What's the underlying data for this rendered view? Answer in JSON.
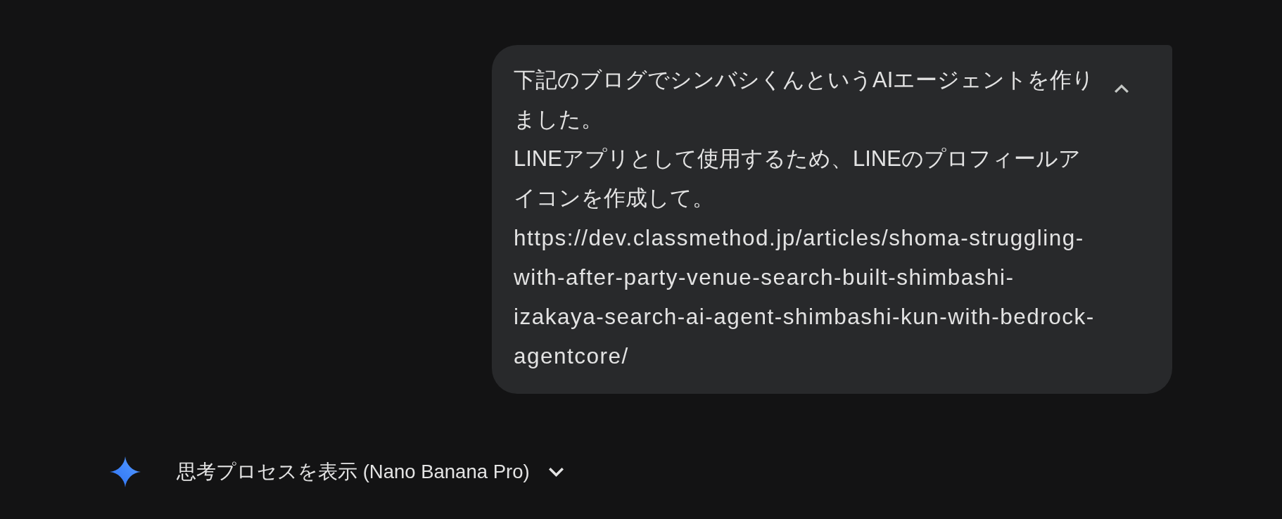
{
  "message": {
    "expanded": true,
    "paragraphs": [
      "下記のブログでシンバシくんというAIエージェントを作りました。",
      "LINEアプリとして使用するため、LINEのプロフィールアイコンを作成して。"
    ],
    "url": "https://dev.classmethod.jp/articles/shoma-struggling-with-after-party-venue-search-built-shimbashi-izakaya-search-ai-agent-shimbashi-kun-with-bedrock-agentcore/"
  },
  "thinking_toggle": {
    "label": "思考プロセスを表示 (Nano Banana Pro)",
    "expanded": false
  }
}
